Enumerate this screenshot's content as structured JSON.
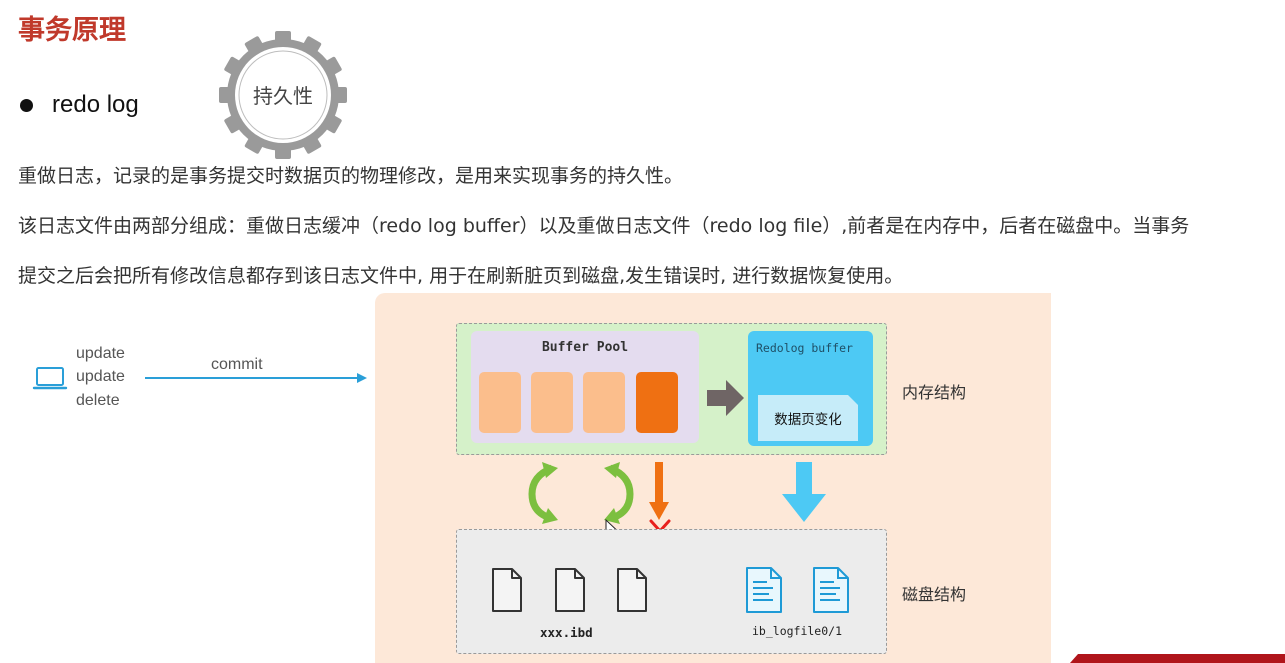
{
  "slide": {
    "title": "事务原理",
    "bullet": "redo log",
    "badge": "持久性",
    "paragraphs": [
      "重做日志，记录的是事务提交时数据页的物理修改，是用来实现事务的持久性。",
      "该日志文件由两部分组成：重做日志缓冲（redo log buffer）以及重做日志文件（redo log file）,前者是在内存中，后者在磁盘中。当事务",
      "提交之后会把所有修改信息都存到该日志文件中, 用于在刷新脏页到磁盘,发生错误时, 进行数据恢复使用。"
    ]
  },
  "diagram": {
    "client_ops": [
      "update",
      "update",
      "delete"
    ],
    "commit_label": "commit",
    "buffer_pool_label": "Buffer Pool",
    "redolog_buffer_label": "Redolog buffer",
    "redolog_content_label": "数据页变化",
    "memory_label": "内存结构",
    "disk_label": "磁盘结构",
    "data_file_label": "xxx.ibd",
    "log_file_label": "ib_logfile0/1"
  },
  "colors": {
    "title": "#c0392b",
    "panel_bg": "#fde8d8",
    "memory_bg": "#d5f1c9",
    "buffer_pool_bg": "#e4dcef",
    "page_light": "#fbbe8c",
    "page_dirty": "#ef7012",
    "redolog_bg": "#4dc9f4",
    "disk_bg": "#ececec",
    "sync_arrows": "#7cbf3f",
    "blue_arrow": "#4dc9f4",
    "failed_cross": "#e8201c"
  },
  "icons": [
    "gear-icon",
    "laptop-icon",
    "commit-arrow-icon",
    "flush-arrow-icon",
    "sync-arrow-icon",
    "cross-icon",
    "file-icon",
    "document-icon",
    "cursor-icon"
  ]
}
